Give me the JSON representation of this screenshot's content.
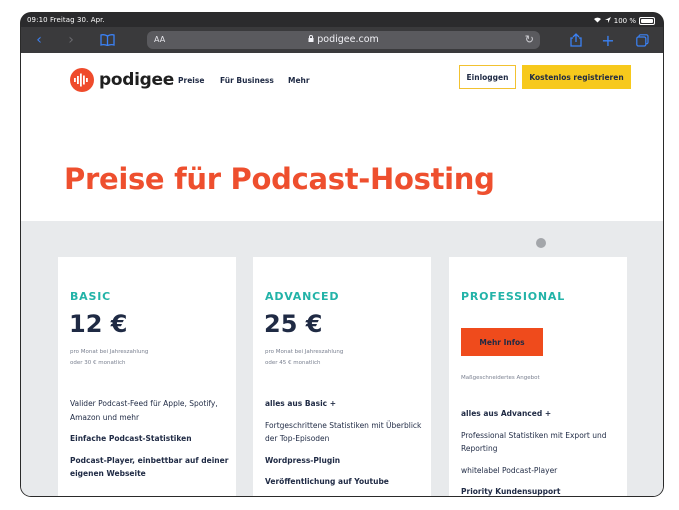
{
  "status_bar": {
    "time_date": "09:10  Freitag 30. Apr.",
    "battery": "100 %"
  },
  "browser": {
    "text_size": "AA",
    "url": "podigee.com"
  },
  "nav": {
    "logo_text": "podigee",
    "links": [
      "Preise",
      "Für Business",
      "Mehr"
    ],
    "login_label": "Einloggen",
    "register_label": "Kostenlos registrieren"
  },
  "hero": {
    "title": "Preise für Podcast-Hosting"
  },
  "plans": [
    {
      "name": "BASIC",
      "price": "12 €",
      "sub1": "pro Monat bei Jahreszahlung",
      "sub2": "oder 30 € monatlich",
      "features": [
        "Valider Podcast-Feed für Apple, Spotify, Amazon und mehr",
        "Einfache Podcast-Statistiken",
        "Podcast-Player, einbettbar auf deiner eigenen Webseite"
      ]
    },
    {
      "name": "ADVANCED",
      "price": "25 €",
      "sub1": "pro Monat bei Jahreszahlung",
      "sub2": "oder 45 € monatlich",
      "features": [
        "alles aus Basic +",
        "Fortgeschrittene Statistiken mit Überblick der Top-Episoden",
        "Wordpress-Plugin",
        "Veröffentlichung auf Youtube"
      ]
    },
    {
      "name": "PROFESSIONAL",
      "button_label": "Mehr Infos",
      "tailored": "Maßgeschneidertes Angebot",
      "features": [
        "alles aus Advanced +",
        "Professional Statistiken mit Export und Reporting",
        "whitelabel Podcast-Player",
        "Priority Kundensupport"
      ]
    }
  ],
  "colors": {
    "brand": "#ee4f2e",
    "accent_yellow": "#f7c91c",
    "plan_teal": "#22b3a8"
  }
}
